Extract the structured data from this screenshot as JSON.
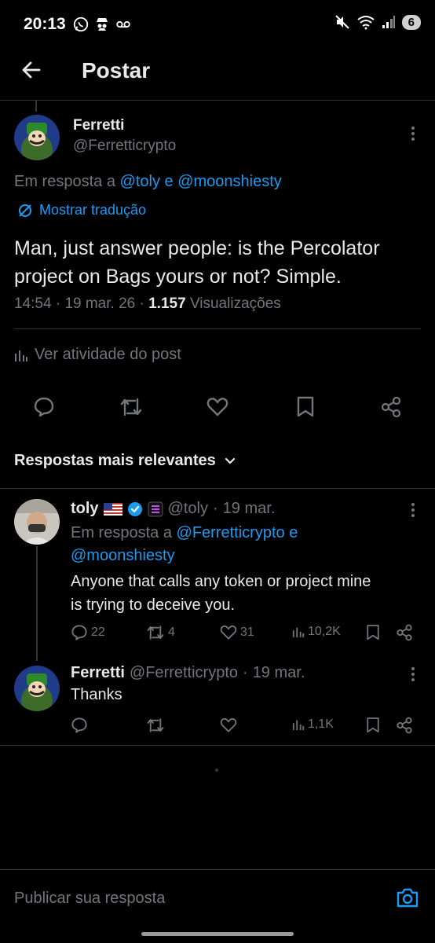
{
  "status_bar": {
    "time": "20:13",
    "battery": "6"
  },
  "header": {
    "title": "Postar"
  },
  "post": {
    "author_name": "Ferretti",
    "author_handle": "@Ferretticrypto",
    "reply_prefix": "Em resposta a",
    "reply_user1": "@toly",
    "reply_and": "e",
    "reply_user2": "@moonshiesty",
    "translate_label": "Mostrar tradução",
    "text_line1": "Man, just answer people: is the Percolator",
    "text_line2": "project on Bags yours or not? Simple.",
    "time": "14:54",
    "dot1": "·",
    "date": "19 mar. 26",
    "dot2": "·",
    "views_count": "1.157",
    "views_label": "Visualizações",
    "activity_label": "Ver atividade do post"
  },
  "replies_filter": {
    "label": "Respostas mais relevantes"
  },
  "replies": [
    {
      "name": "toly",
      "flag": "🇺🇸",
      "handle": "@toly",
      "dot": "·",
      "date": "19 mar.",
      "reply_prefix": "Em resposta a",
      "reply_user1": "@Ferretticrypto",
      "reply_and": "e",
      "reply_user2": "@moonshiesty",
      "text_line1": "Anyone that calls any token or project mine",
      "text_line2": "is trying to deceive you.",
      "comments": "22",
      "retweets": "4",
      "likes": "31",
      "views": "10,2K"
    },
    {
      "name": "Ferretti",
      "handle": "@Ferretticrypto",
      "dot": "·",
      "date": "19 mar.",
      "text": "Thanks",
      "views": "1,1K"
    }
  ],
  "composer": {
    "placeholder": "Publicar sua resposta"
  },
  "colors": {
    "background": "#000000",
    "text": "#e7e9ea",
    "muted": "#71767b",
    "link": "#1d9bf0",
    "separator": "#2f3336"
  }
}
